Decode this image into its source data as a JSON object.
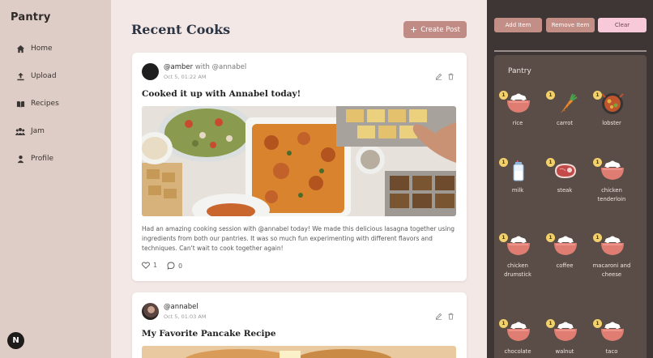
{
  "sidebar": {
    "brand": "Pantry",
    "items": [
      {
        "label": "Home",
        "icon": "home-icon"
      },
      {
        "label": "Upload",
        "icon": "upload-icon"
      },
      {
        "label": "Recipes",
        "icon": "book-icon"
      },
      {
        "label": "Jam",
        "icon": "group-icon"
      },
      {
        "label": "Profile",
        "icon": "user-icon"
      }
    ],
    "badge": "N"
  },
  "main": {
    "title": "Recent Cooks",
    "create_label": "Create Post",
    "posts": [
      {
        "author": "@amber",
        "with_text": "with @annabel",
        "time": "Oct 5, 01:22 AM",
        "title": "Cooked it up with Annabel today!",
        "body": "Had an amazing cooking session with @annabel today! We made this delicious lasagna together using ingredients from both our pantries. It was so much fun experimenting with different flavors and techniques. Can't wait to cook together again!",
        "likes": "1",
        "comments": "0"
      },
      {
        "author": "@annabel",
        "with_text": "",
        "time": "Oct 5, 01:03 AM",
        "title": "My Favorite Pancake Recipe"
      }
    ]
  },
  "panel": {
    "add_label": "Add Item",
    "remove_label": "Remove Item",
    "clear_label": "Clear",
    "pantry_title": "Pantry",
    "items": [
      {
        "name": "rice",
        "count": "1",
        "icon": "rice-bowl-icon"
      },
      {
        "name": "carrot",
        "count": "1",
        "icon": "carrot-icon"
      },
      {
        "name": "lobster",
        "count": "1",
        "icon": "lobster-dish-icon"
      },
      {
        "name": "milk",
        "count": "1",
        "icon": "milk-icon"
      },
      {
        "name": "steak",
        "count": "1",
        "icon": "steak-icon"
      },
      {
        "name": "chicken tenderloin",
        "count": "1",
        "icon": "rice-bowl-icon"
      },
      {
        "name": "chicken drumstick",
        "count": "1",
        "icon": "rice-bowl-icon"
      },
      {
        "name": "coffee",
        "count": "1",
        "icon": "rice-bowl-icon"
      },
      {
        "name": "macaroni and cheese",
        "count": "1",
        "icon": "rice-bowl-icon"
      },
      {
        "name": "chocolate",
        "count": "1",
        "icon": "rice-bowl-icon"
      },
      {
        "name": "walnut",
        "count": "1",
        "icon": "rice-bowl-icon"
      },
      {
        "name": "taco",
        "count": "1",
        "icon": "rice-bowl-icon"
      }
    ]
  }
}
